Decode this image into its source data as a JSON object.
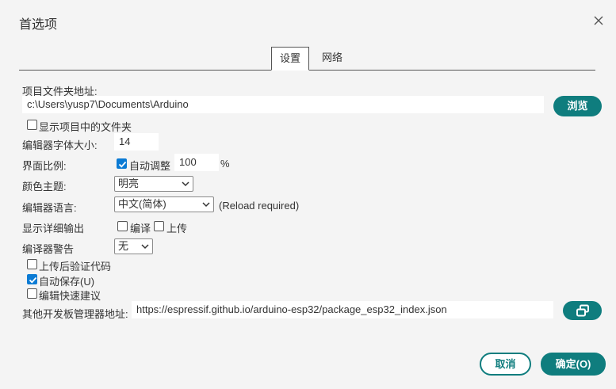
{
  "window": {
    "title": "首选项"
  },
  "tabs": [
    {
      "label": "设置",
      "active": true
    },
    {
      "label": "网络",
      "active": false
    }
  ],
  "sketchbook": {
    "label": "项目文件夹地址:",
    "value": "c:\\Users\\yusp7\\Documents\\Arduino",
    "browse_label": "浏览",
    "show_files_label": "显示项目中的文件夹",
    "show_files_checked": false
  },
  "font_size": {
    "label": "编辑器字体大小:",
    "value": "14"
  },
  "scale": {
    "label": "界面比例:",
    "auto_label": "自动调整",
    "auto_checked": true,
    "value": "100",
    "unit": "%"
  },
  "theme": {
    "label": "颜色主题:",
    "selected": "明亮"
  },
  "language": {
    "label": "编辑器语言:",
    "selected": "中文(简体)",
    "note": "(Reload required)"
  },
  "verbose": {
    "label": "显示详细输出",
    "compile_label": "编译",
    "compile_checked": false,
    "upload_label": "上传",
    "upload_checked": false
  },
  "warnings": {
    "label": "编译器警告",
    "selected": "无"
  },
  "options": [
    {
      "label": "上传后验证代码",
      "checked": false
    },
    {
      "label": "自动保存(U)",
      "checked": true
    },
    {
      "label": "编辑快速建议",
      "checked": false
    }
  ],
  "boards_manager": {
    "label": "其他开发板管理器地址:",
    "value": "https://espressif.github.io/arduino-esp32/package_esp32_index.json"
  },
  "footer": {
    "cancel_label": "取消",
    "ok_label": "确定(O)"
  },
  "colors": {
    "accent": "#0f7d7e",
    "checkbox": "#0b7bd4",
    "background": "#f4f4f4"
  }
}
